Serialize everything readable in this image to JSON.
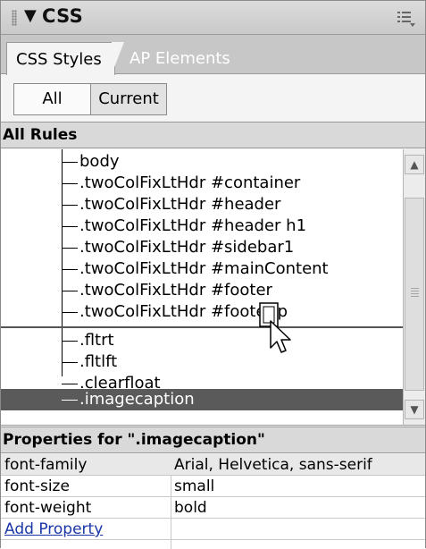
{
  "panel": {
    "title": "CSS",
    "collapse_glyph": "▼",
    "grip_icon": "grip-icon",
    "options_icon": "options-menu-icon"
  },
  "tabs": [
    {
      "label": "CSS Styles",
      "active": true
    },
    {
      "label": "AP Elements",
      "active": false
    }
  ],
  "mode_buttons": {
    "all": "All",
    "current": "Current"
  },
  "rules_section": {
    "heading": "All Rules",
    "rules": [
      {
        "label": "body",
        "selected": false
      },
      {
        "label": ".twoColFixLtHdr #container",
        "selected": false
      },
      {
        "label": ".twoColFixLtHdr #header",
        "selected": false
      },
      {
        "label": ".twoColFixLtHdr #header h1",
        "selected": false
      },
      {
        "label": ".twoColFixLtHdr #sidebar1",
        "selected": false
      },
      {
        "label": ".twoColFixLtHdr #mainContent",
        "selected": false
      },
      {
        "label": ".twoColFixLtHdr #footer",
        "selected": false
      },
      {
        "label": ".twoColFixLtHdr #footer p",
        "selected": false
      },
      {
        "label": ".fltrt",
        "selected": false
      },
      {
        "label": ".fltlft",
        "selected": false
      },
      {
        "label": ".clearfloat",
        "selected": false
      },
      {
        "label": ".imagecaption",
        "selected": true
      }
    ]
  },
  "properties_section": {
    "heading": "Properties for \".imagecaption\"",
    "rows": [
      {
        "name": "font-family",
        "value": "Arial, Helvetica, sans-serif"
      },
      {
        "name": "font-size",
        "value": "small"
      },
      {
        "name": "font-weight",
        "value": "bold"
      }
    ],
    "add_property": "Add Property"
  },
  "colors": {
    "selection": "#5a5a5a",
    "link": "#1a36a8"
  }
}
